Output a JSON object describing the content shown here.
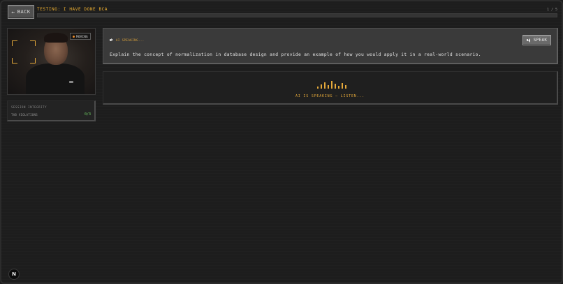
{
  "header": {
    "back_label": "BACK",
    "back_icon": "←",
    "title": "TESTING: I HAVE DONE BCA",
    "counter": "1 / 5",
    "progress": 0.0
  },
  "camera": {
    "status": "MOVING",
    "status_color": "#ef8c2a"
  },
  "integrity": {
    "title": "SESSION INTEGRITY",
    "violations_label": "TAB VIOLATIONS",
    "violations_value": "0/3"
  },
  "question": {
    "speaking_tag": "AI SPEAKING...",
    "text": "Explain the concept of normalization in database design and provide an example of how you would apply it in a real-world scenario.",
    "speak_label": "SPEAK"
  },
  "speaking": {
    "status": "AI IS SPEAKING — LISTEN...",
    "accent": "#e3a83a"
  },
  "footer": {
    "logo_letter": "N"
  }
}
